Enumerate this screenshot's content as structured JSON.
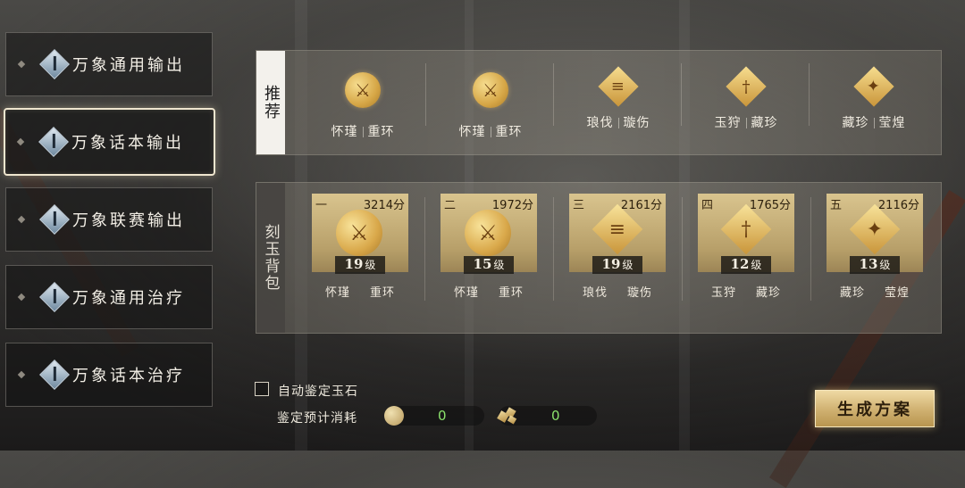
{
  "sidebar": {
    "items": [
      {
        "label": "万象通用输出",
        "active": false
      },
      {
        "label": "万象话本输出",
        "active": true
      },
      {
        "label": "万象联赛输出",
        "active": false
      },
      {
        "label": "万象通用治疗",
        "active": false
      },
      {
        "label": "万象话本治疗",
        "active": false
      }
    ]
  },
  "recommend": {
    "tag": "推荐",
    "slots": [
      {
        "icon": "dagger-coin-icon",
        "name1": "怀瑾",
        "name2": "重环"
      },
      {
        "icon": "dagger-coin-icon",
        "name1": "怀瑾",
        "name2": "重环"
      },
      {
        "icon": "comb-diamond-icon",
        "name1": "琅伐",
        "name2": "璇伤"
      },
      {
        "icon": "sword-diamond-icon",
        "name1": "玉狩",
        "name2": "藏珍"
      },
      {
        "icon": "phoenix-diamond-icon",
        "name1": "藏珍",
        "name2": "莹煌"
      }
    ]
  },
  "bag": {
    "tag": "刻玉背包",
    "cards": [
      {
        "rank": "一",
        "score": "3214分",
        "level": "19",
        "level_unit": "级",
        "name1": "怀瑾",
        "name2": "重环",
        "icon": "dagger-coin-icon"
      },
      {
        "rank": "二",
        "score": "1972分",
        "level": "15",
        "level_unit": "级",
        "name1": "怀瑾",
        "name2": "重环",
        "icon": "dagger-coin-icon"
      },
      {
        "rank": "三",
        "score": "2161分",
        "level": "19",
        "level_unit": "级",
        "name1": "琅伐",
        "name2": "璇伤",
        "icon": "comb-diamond-icon"
      },
      {
        "rank": "四",
        "score": "1765分",
        "level": "12",
        "level_unit": "级",
        "name1": "玉狩",
        "name2": "藏珍",
        "icon": "sword-diamond-icon"
      },
      {
        "rank": "五",
        "score": "2116分",
        "level": "13",
        "level_unit": "级",
        "name1": "藏珍",
        "name2": "莹煌",
        "icon": "phoenix-diamond-icon"
      }
    ]
  },
  "footer": {
    "auto_identify_label": "自动鉴定玉石",
    "cost_label": "鉴定预计消耗",
    "cost1": "0",
    "cost2": "0",
    "generate_button": "生成方案"
  },
  "colors": {
    "gold": "#d6a646",
    "cost_green": "#8be26c"
  }
}
